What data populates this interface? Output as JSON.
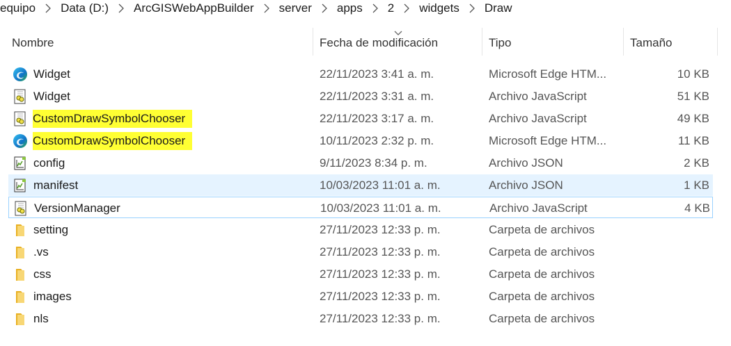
{
  "breadcrumb": [
    "equipo",
    "Data (D:)",
    "ArcGISWebAppBuilder",
    "server",
    "apps",
    "2",
    "widgets",
    "Draw"
  ],
  "columns": {
    "name": "Nombre",
    "date": "Fecha de modificación",
    "type": "Tipo",
    "size": "Tamaño"
  },
  "files": [
    {
      "name": "Widget",
      "date": "22/11/2023 3:41 a. m.",
      "type": "Microsoft Edge HTM...",
      "size": "10 KB",
      "icon": "edge-icon"
    },
    {
      "name": "Widget",
      "date": "22/11/2023 3:31 a. m.",
      "type": "Archivo JavaScript",
      "size": "51 KB",
      "icon": "javascript-file-icon"
    },
    {
      "name": "CustomDrawSymbolChooser",
      "date": "22/11/2023 3:17 a. m.",
      "type": "Archivo JavaScript",
      "size": "49 KB",
      "icon": "javascript-file-icon",
      "highlight": true
    },
    {
      "name": "CustomDrawSymbolChooser",
      "date": "10/11/2023 2:32 p. m.",
      "type": "Microsoft Edge HTM...",
      "size": "11 KB",
      "icon": "edge-icon",
      "highlight": true
    },
    {
      "name": "config",
      "date": "9/11/2023 8:34 p. m.",
      "type": "Archivo JSON",
      "size": "2 KB",
      "icon": "json-file-icon"
    },
    {
      "name": "manifest",
      "date": "10/03/2023 11:01 a. m.",
      "type": "Archivo JSON",
      "size": "1 KB",
      "icon": "json-file-icon",
      "state": "hover"
    },
    {
      "name": "VersionManager",
      "date": "10/03/2023 11:01 a. m.",
      "type": "Archivo JavaScript",
      "size": "4 KB",
      "icon": "javascript-file-icon",
      "state": "focus"
    },
    {
      "name": "setting",
      "date": "27/11/2023 12:33 p. m.",
      "type": "Carpeta de archivos",
      "size": "",
      "icon": "folder-icon"
    },
    {
      "name": ".vs",
      "date": "27/11/2023 12:33 p. m.",
      "type": "Carpeta de archivos",
      "size": "",
      "icon": "folder-icon"
    },
    {
      "name": "css",
      "date": "27/11/2023 12:33 p. m.",
      "type": "Carpeta de archivos",
      "size": "",
      "icon": "folder-icon"
    },
    {
      "name": "images",
      "date": "27/11/2023 12:33 p. m.",
      "type": "Carpeta de archivos",
      "size": "",
      "icon": "folder-icon"
    },
    {
      "name": "nls",
      "date": "27/11/2023 12:33 p. m.",
      "type": "Carpeta de archivos",
      "size": "",
      "icon": "folder-icon"
    }
  ],
  "colors": {
    "highlight": "#ffff33",
    "hover_row": "#e5f3ff",
    "focus_border": "#99d1ff",
    "folder": "#f4c542"
  }
}
